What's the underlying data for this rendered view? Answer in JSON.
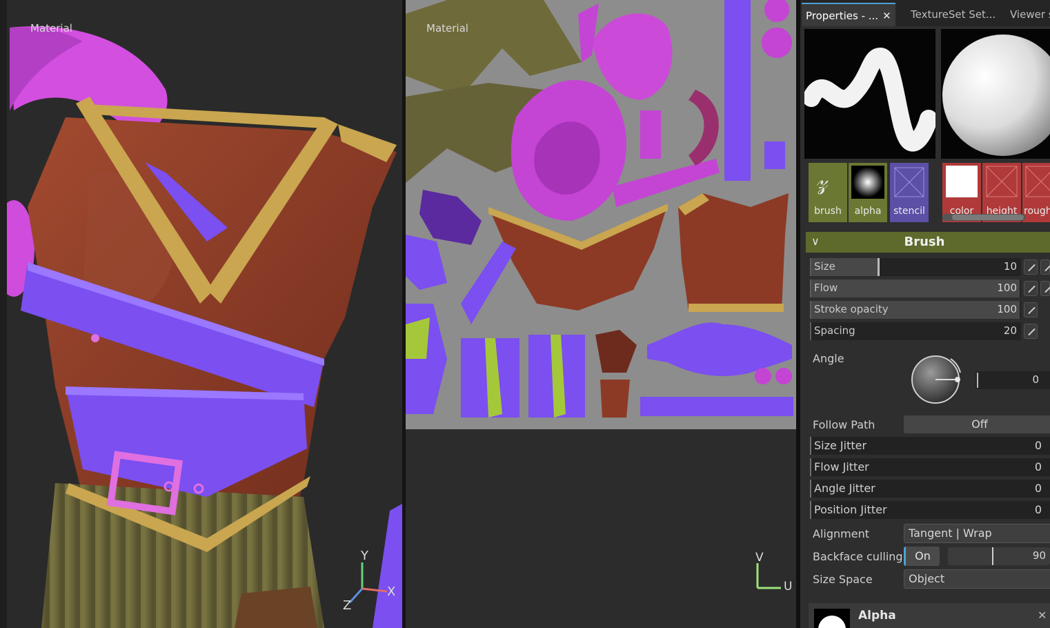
{
  "viewport3d": {
    "label": "Material",
    "axes": {
      "y": "Y",
      "x": "X",
      "z": "Z"
    }
  },
  "viewport2d": {
    "label": "Material",
    "axes": {
      "v": "V",
      "u": "U"
    }
  },
  "panel": {
    "tabs": [
      {
        "label": "Properties - ...",
        "active": true,
        "closable": true
      },
      {
        "label": "TextureSet Set...",
        "active": false,
        "closable": false
      },
      {
        "label": "Viewer s",
        "active": false,
        "closable": false
      }
    ],
    "channels": {
      "brush": "brush",
      "alpha": "alpha",
      "stencil": "stencil",
      "color": "color",
      "height": "height",
      "rough": "rough"
    },
    "brush_section": {
      "title": "Brush",
      "size": {
        "label": "Size",
        "value": "10",
        "level": 0.3
      },
      "flow": {
        "label": "Flow",
        "value": "100",
        "level": 1.0
      },
      "stroke_opacity": {
        "label": "Stroke opacity",
        "value": "100",
        "level": 1.0
      },
      "spacing": {
        "label": "Spacing",
        "value": "20",
        "level": 0.0
      },
      "angle": {
        "label": "Angle",
        "value": "0"
      },
      "follow_path": {
        "label": "Follow Path",
        "value": "Off"
      },
      "size_jitter": {
        "label": "Size Jitter",
        "value": "0"
      },
      "flow_jitter": {
        "label": "Flow Jitter",
        "value": "0"
      },
      "angle_jitter": {
        "label": "Angle Jitter",
        "value": "0"
      },
      "position_jitter": {
        "label": "Position Jitter",
        "value": "0"
      },
      "alignment": {
        "label": "Alignment",
        "value": "Tangent | Wrap"
      },
      "backface_culling": {
        "label": "Backface culling",
        "toggle": "On",
        "value": "90"
      },
      "size_space": {
        "label": "Size Space",
        "value": "Object"
      }
    },
    "alpha_section": {
      "title": "Alpha"
    }
  },
  "colors": {
    "accent_tab": "#4aa3d6",
    "brush_header": "#5d6a2c",
    "brush_channel_bg": "#6b7833",
    "stencil_bg": "#5b4fa6",
    "material_channel_bg": "#b03a3a",
    "purple_strap": "#7b4ff0",
    "magenta": "#d24fe0",
    "leather": "#8c3a25",
    "gold_trim": "#c9a64f",
    "pants": "#6e6a3a"
  }
}
